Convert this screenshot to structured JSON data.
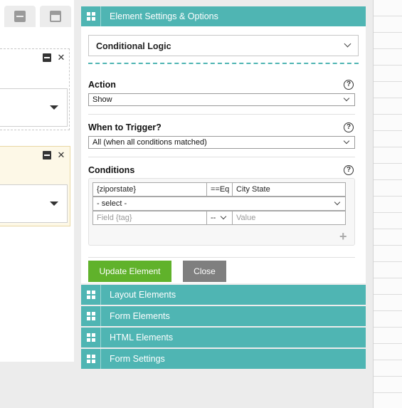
{
  "panel": {
    "header": {
      "title": "Element Settings & Options",
      "icon": "grid-icon"
    },
    "logic_select": {
      "value": "Conditional Logic"
    },
    "action": {
      "label": "Action",
      "value": "Show",
      "help": "?"
    },
    "trigger": {
      "label": "When to Trigger?",
      "value": "All (when all conditions matched)",
      "help": "?"
    },
    "conditions": {
      "label": "Conditions",
      "help": "?",
      "row1": {
        "field": "{ziporstate}",
        "operator": "==Eq",
        "value": "City State"
      },
      "row1_select": {
        "value": "- select -"
      },
      "row2": {
        "field_placeholder": "Field {tag}",
        "operator": "--",
        "value_placeholder": "Value"
      },
      "add_icon": "plus-icon"
    },
    "buttons": {
      "update": "Update Element",
      "close": "Close"
    }
  },
  "sections": [
    {
      "label": "Layout Elements"
    },
    {
      "label": "Form Elements"
    },
    {
      "label": "HTML Elements"
    },
    {
      "label": "Form Settings"
    }
  ],
  "colors": {
    "accent": "#4fb5b3",
    "update_button": "#60b22b",
    "close_button": "#7f7f7f",
    "highlight_block": "#fdf8e7"
  }
}
